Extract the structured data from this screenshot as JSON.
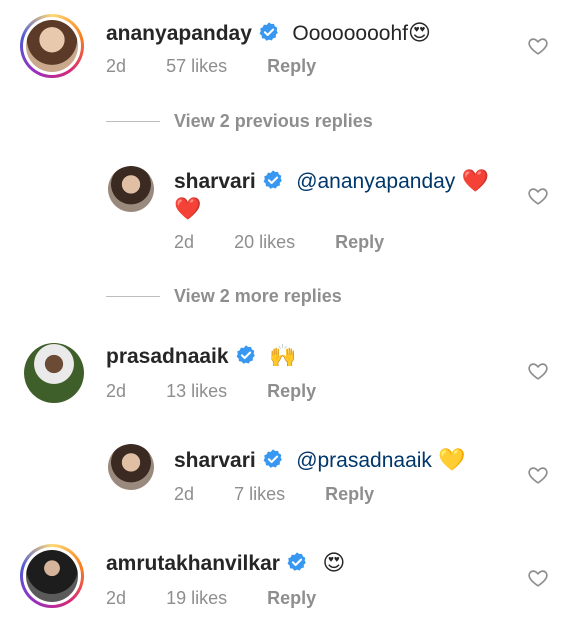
{
  "comments": [
    {
      "username": "ananyapanday",
      "text": "Oooooooohf",
      "emoji": "😍",
      "time": "2d",
      "likes": "57 likes",
      "reply": "Reply"
    },
    {
      "username": "prasadnaaik",
      "text": "",
      "emoji": "🙌",
      "time": "2d",
      "likes": "13 likes",
      "reply": "Reply"
    },
    {
      "username": "amrutakhanvilkar",
      "text": "",
      "emoji": "😍",
      "time": "2d",
      "likes": "19 likes",
      "reply": "Reply"
    }
  ],
  "replies": [
    {
      "username": "sharvari",
      "mention": "@ananyapanday",
      "emoji": "❤️",
      "emoji2": "❤️",
      "time": "2d",
      "likes": "20 likes",
      "reply": "Reply"
    },
    {
      "username": "sharvari",
      "mention": "@prasadnaaik",
      "emoji": "💛",
      "time": "2d",
      "likes": "7 likes",
      "reply": "Reply"
    }
  ],
  "view_previous": "View 2 previous replies",
  "view_more": "View 2 more replies",
  "colors": {
    "verified": "#3897f0",
    "heart_red": "#ed4956",
    "muted": "#8e8e8e",
    "mention": "#00376b"
  },
  "icons": [
    "verified-badge-icon",
    "heart-outline-icon"
  ]
}
